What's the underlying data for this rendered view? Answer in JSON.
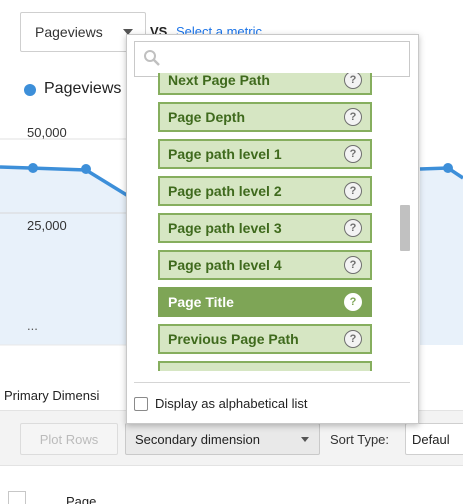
{
  "metric_selector": {
    "value": "Pageviews",
    "vs": "VS.",
    "select_metric": "Select a metric"
  },
  "legend": {
    "label": "Pageviews",
    "color": "#3d8fd9"
  },
  "chart_data": {
    "type": "line",
    "series": [
      {
        "name": "Pageviews"
      }
    ],
    "yticks": [
      "50,000",
      "25,000"
    ],
    "footer": "...",
    "grid": true
  },
  "primary_dimension": {
    "label": "Primary Dimensi"
  },
  "toolbar": {
    "plot_rows": "Plot Rows",
    "secondary_dimension": "Secondary dimension",
    "sort_type_label": "Sort Type:",
    "sort_value": "Defaul"
  },
  "table": {
    "header_partial": "Page"
  },
  "dropdown": {
    "search_placeholder": "",
    "items": [
      {
        "label": "Next Page Path",
        "help": "?"
      },
      {
        "label": "Page Depth",
        "help": "?"
      },
      {
        "label": "Page path level 1",
        "help": "?"
      },
      {
        "label": "Page path level 2",
        "help": "?"
      },
      {
        "label": "Page path level 3",
        "help": "?"
      },
      {
        "label": "Page path level 4",
        "help": "?"
      },
      {
        "label": "Page Title",
        "help": "?",
        "selected": true
      },
      {
        "label": "Previous Page Path",
        "help": "?"
      }
    ],
    "alphabetical_label": "Display as alphabetical list",
    "item_color": "#d6e6c3",
    "selected_color": "#7ea556"
  }
}
